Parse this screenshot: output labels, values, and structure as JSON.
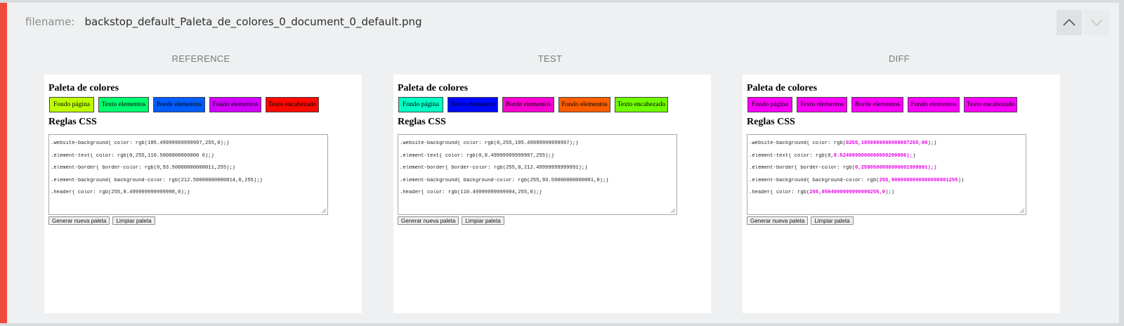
{
  "header": {
    "filename_label": "filename:",
    "filename_value": "backstop_default_Paleta_de_colores_0_document_0_default.png"
  },
  "nav": {
    "up_icon": "chevron-up-icon",
    "down_icon": "chevron-down-icon"
  },
  "accent_color": "#ef4b3b",
  "columns": [
    {
      "header": "REFERENCE",
      "title": "Paleta de colores",
      "rules_title": "Reglas CSS",
      "swatches": [
        {
          "label": "Fondo página",
          "color": "#bdff00"
        },
        {
          "label": "Texto elementos",
          "color": "#00ff6e"
        },
        {
          "label": "Borde elementos",
          "color": "#005dff"
        },
        {
          "label": "Fondo elementos",
          "color": "#d400ff"
        },
        {
          "label": "Texto encabezado",
          "color": "#ff0900"
        }
      ],
      "css_lines": [
        ".website-background{ color: rgb(185.49999999999997,255,0);}",
        ".element-text{ color: rgb(0,255,110.5000000000000 6);}",
        ".element-border{ border-color: rgb(0,93.50000000000011,255);}",
        ".element-background{ background-color: rgb(212.50000000000014,0,255);}",
        ".header{ color: rgb(255,8.499999999999998,0);}"
      ],
      "buttons": {
        "generate": "Generar nueva paleta",
        "clear": "Limpiar paleta"
      }
    },
    {
      "header": "TEST",
      "title": "Paleta de colores",
      "rules_title": "Reglas CSS",
      "swatches": [
        {
          "label": "Fondo página",
          "color": "#00ffc4"
        },
        {
          "label": "Texto elementos",
          "color": "#0009ff"
        },
        {
          "label": "Borde elementos",
          "color": "#ff00d4"
        },
        {
          "label": "Fondo elementos",
          "color": "#ff5d00"
        },
        {
          "label": "Texto encabezado",
          "color": "#6eff00"
        }
      ],
      "css_lines": [
        ".website-background{ color: rgb(0,255,195.49999999999997);}",
        ".element-text{ color: rgb(0,8.49999999999997,255);}",
        ".element-border{ border-color: rgb(255,0,212.49999999999991);}",
        ".element-background{ background-color: rgb(255,93.50000000000001,0);}",
        ".header{ color: rgb(110.49999999999994,255,0);}"
      ],
      "buttons": {
        "generate": "Generar nueva paleta",
        "clear": "Limpiar paleta"
      }
    },
    {
      "header": "DIFF",
      "title": "Paleta de colores",
      "rules_title": "Reglas CSS",
      "swatches": [
        {
          "label": "Fondo página",
          "color": "#ff00ff"
        },
        {
          "label": "Texto elementos",
          "color": "#ff00ff"
        },
        {
          "label": "Borde elementos",
          "color": "#ff00ff"
        },
        {
          "label": "Fondo elementos",
          "color": "#ff00ff"
        },
        {
          "label": "Texto encabezado",
          "color": "#ff00ff"
        }
      ],
      "css_lines": [
        {
          "plain": ".website-background{ color: rgb(",
          "diff": "0255,1959999999999997255,00",
          "tail": ");}"
        },
        {
          "plain": ".element-text{ color: rgb(0,",
          "diff": "8.5249999000000000299996);",
          "tail": "}"
        },
        {
          "plain": ".element-border{ border-color: rgb(",
          "diff": "0,2590500000000001999991);",
          "tail": ")"
        },
        {
          "plain": ".element-background{ background-color: rgb(",
          "diff": "255,9000000000000000001255",
          "tail": "))"
        },
        {
          "plain": ".header{ color: rgb(",
          "diff": "255,8594999999999999255,0",
          "tail": ");)"
        }
      ],
      "buttons": {
        "generate": "Generar nueva paleta",
        "clear": "Limpiar paleta"
      }
    }
  ]
}
